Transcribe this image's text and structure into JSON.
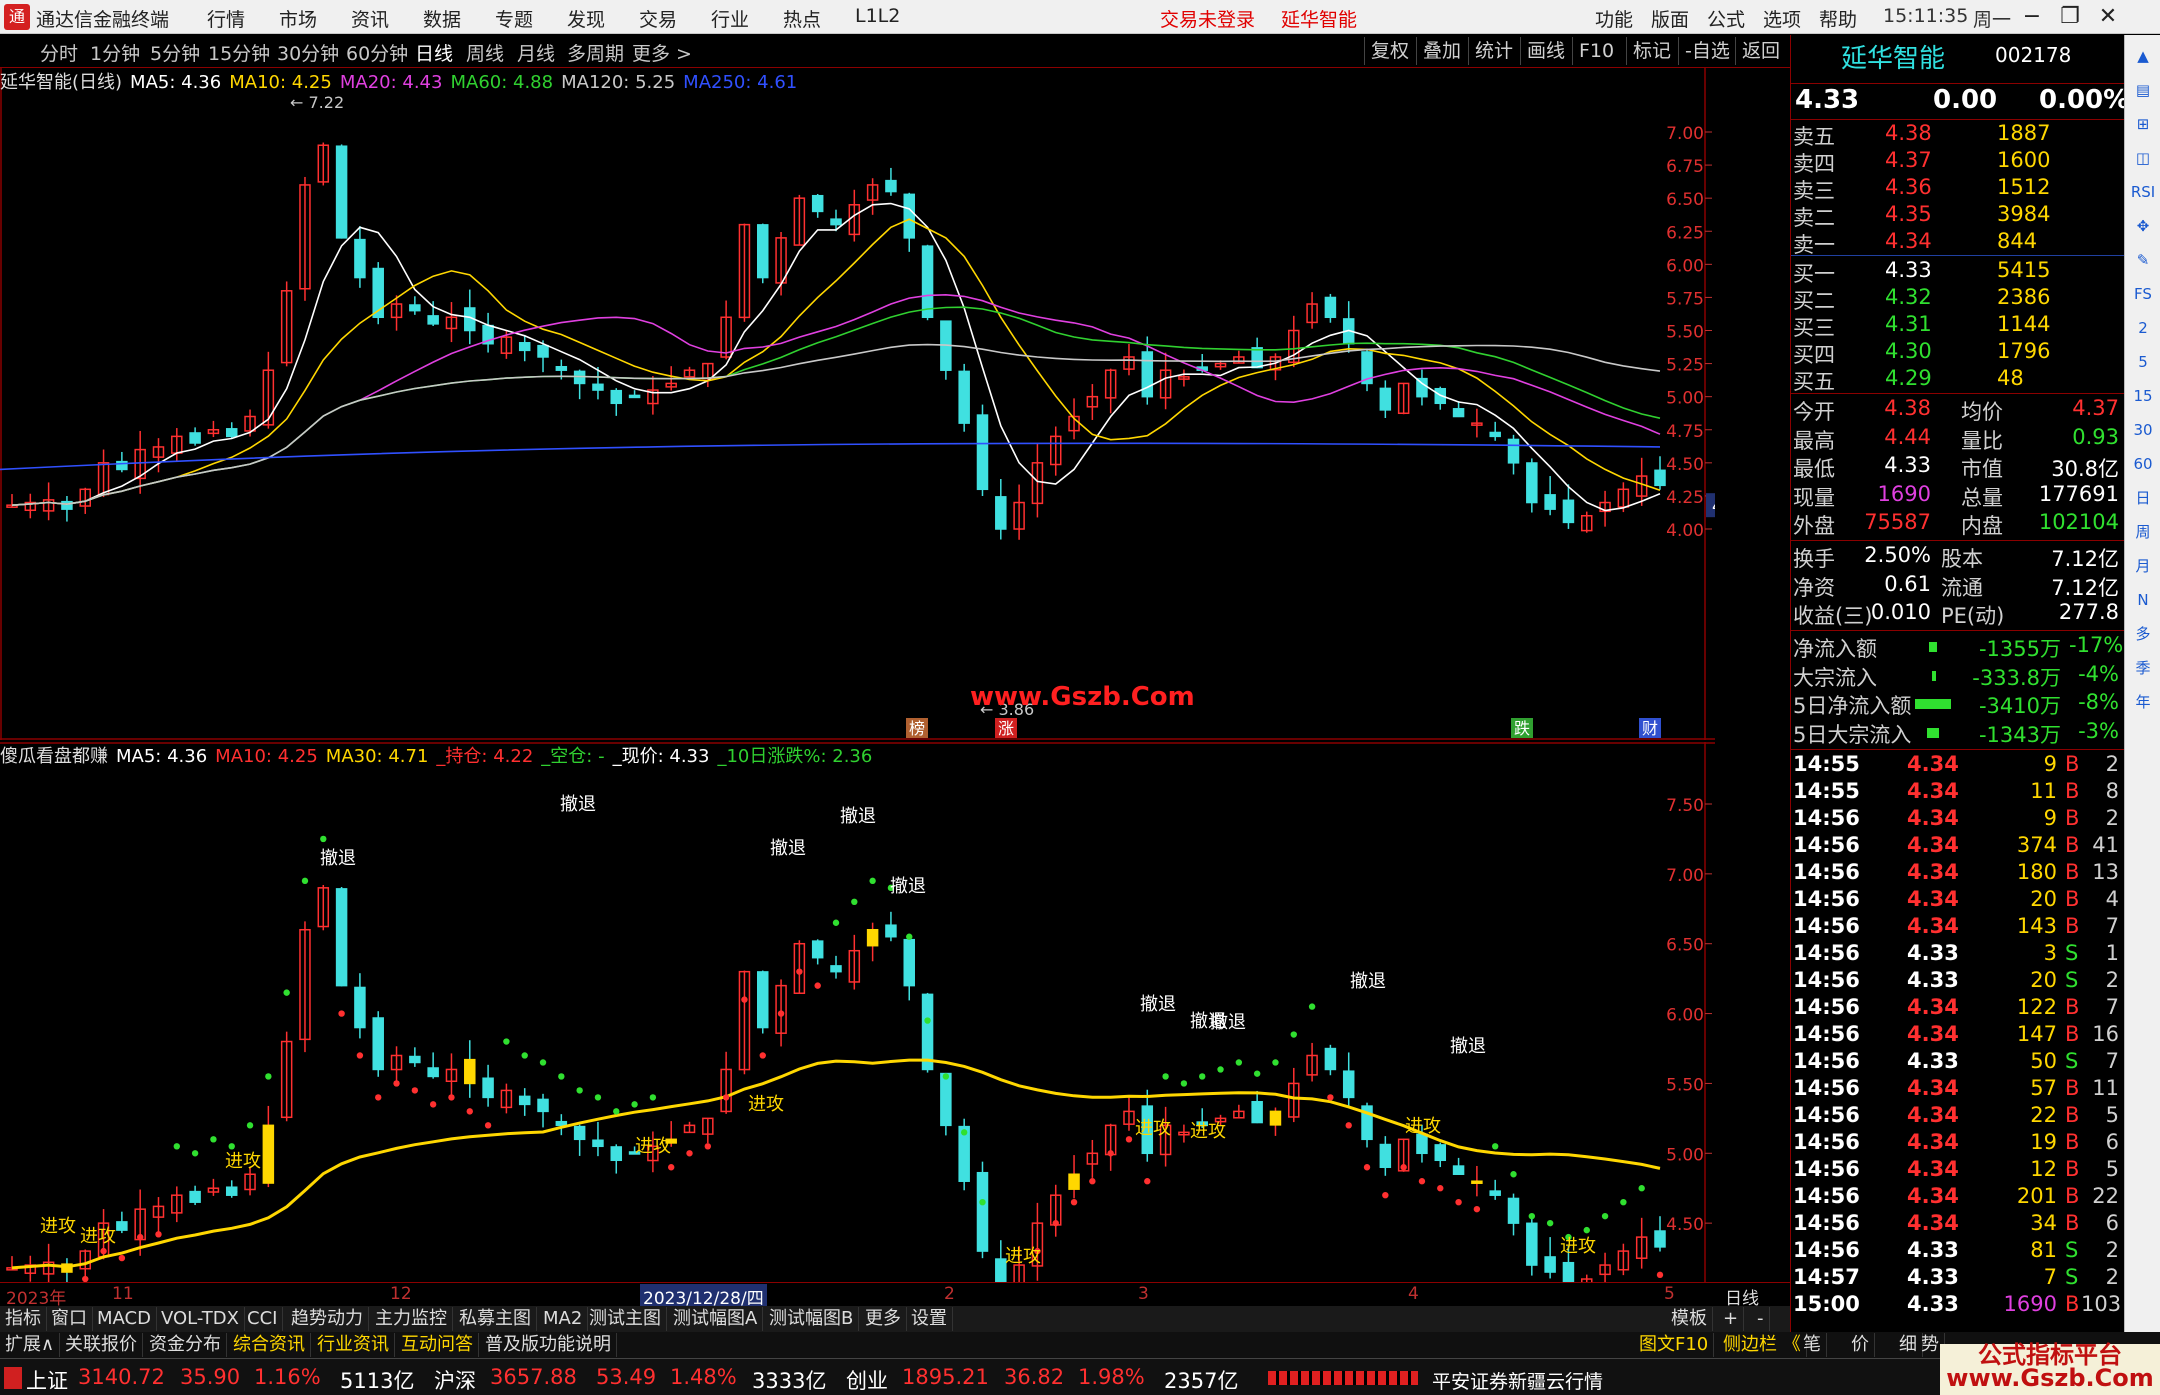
{
  "app": {
    "logo_glyph": "通",
    "title": "通达信金融终端",
    "menus": [
      "行情",
      "市场",
      "资讯",
      "数据",
      "专题",
      "发现",
      "交易",
      "行业",
      "热点",
      "L1L2"
    ],
    "center_links": [
      "交易未登录",
      "延华智能"
    ],
    "right_menus": [
      "功能",
      "版面",
      "公式",
      "选项",
      "帮助"
    ],
    "clock": "15:11:35",
    "weekday": "周一"
  },
  "periods": {
    "items": [
      "分时",
      "1分钟",
      "5分钟",
      "15分钟",
      "30分钟",
      "60分钟",
      "日线",
      "周线",
      "月线",
      "多周期",
      "更多 >"
    ],
    "active": "日线",
    "tools": [
      "复权",
      "叠加",
      "统计",
      "画线",
      "F10",
      "标记",
      "-自选",
      "返回"
    ]
  },
  "main_indicator": {
    "label": "延华智能(日线)",
    "items": [
      {
        "text": "MA5: 4.36",
        "color": "#ffffff"
      },
      {
        "text": "MA10: 4.25",
        "color": "#ffd700"
      },
      {
        "text": "MA20: 4.43",
        "color": "#e040e0"
      },
      {
        "text": "MA60: 4.88",
        "color": "#30d030"
      },
      {
        "text": "MA120: 5.25",
        "color": "#c8c8c8"
      },
      {
        "text": "MA250: 4.61",
        "color": "#3050ff"
      }
    ]
  },
  "main_axis": {
    "ticks": [
      "7.00",
      "6.75",
      "6.50",
      "6.25",
      "6.00",
      "5.75",
      "5.50",
      "5.25",
      "5.00",
      "4.75",
      "4.50",
      "4.25",
      "4.00"
    ],
    "current_price_tag": "4.18",
    "high_mark": "7.22",
    "low_mark": "3.86",
    "event_marks": [
      "榜",
      "涨",
      "跌",
      "财"
    ]
  },
  "sub_indicator": {
    "label": "傻瓜看盘都赚",
    "items": [
      {
        "text": "MA5: 4.36",
        "color": "#ffffff"
      },
      {
        "text": "MA10: 4.25",
        "color": "#ff3030"
      },
      {
        "text": "MA30: 4.71",
        "color": "#ffd700"
      },
      {
        "text": "_持仓: 4.22",
        "color": "#ff3030"
      },
      {
        "text": "_空仓: -",
        "color": "#30d030"
      },
      {
        "text": "_现价: 4.33",
        "color": "#ffffff"
      },
      {
        "text": "_10日涨跌%: 2.36",
        "color": "#30d030"
      }
    ],
    "ticks": [
      "7.50",
      "7.00",
      "6.50",
      "6.00",
      "5.50",
      "5.00",
      "4.50",
      "4.00"
    ],
    "signal_retreat": "撤退",
    "signal_attack": "进攻"
  },
  "watermark_site": "www.Gszb.Com",
  "time_axis": {
    "labels": [
      "2023年",
      "11",
      "12",
      "2023/12/28/四",
      "2",
      "3",
      "4",
      "5"
    ],
    "period": "日线"
  },
  "tabs1": [
    "指标",
    "窗口",
    "MACD",
    "VOL-TDX",
    "CCI",
    "趋势动力",
    "主力监控",
    "私募主图",
    "MA2",
    "测试主图",
    "测试幅图A",
    "测试幅图B",
    "更多",
    "设置"
  ],
  "tabs1_right": [
    "模板",
    "+",
    "-"
  ],
  "tabs2": [
    "扩展∧",
    "关联报价",
    "资金分布",
    "综合资讯",
    "行业资讯",
    "互动问答",
    "普及版功能说明"
  ],
  "tabs2_right": [
    "图文F10",
    "侧边栏 《",
    "笔",
    "价",
    "细",
    "势"
  ],
  "quote": {
    "name": "延华智能",
    "code": "002178",
    "price": "4.33",
    "change": "0.00",
    "change_pct": "0.00%",
    "asks": [
      {
        "label": "卖五",
        "price": "4.38",
        "vol": "1887"
      },
      {
        "label": "卖四",
        "price": "4.37",
        "vol": "1600"
      },
      {
        "label": "卖三",
        "price": "4.36",
        "vol": "1512"
      },
      {
        "label": "卖二",
        "price": "4.35",
        "vol": "3984"
      },
      {
        "label": "卖一",
        "price": "4.34",
        "vol": "844"
      }
    ],
    "bids": [
      {
        "label": "买一",
        "price": "4.33",
        "vol": "5415"
      },
      {
        "label": "买二",
        "price": "4.32",
        "vol": "2386"
      },
      {
        "label": "买三",
        "price": "4.31",
        "vol": "1144"
      },
      {
        "label": "买四",
        "price": "4.30",
        "vol": "1796"
      },
      {
        "label": "买五",
        "price": "4.29",
        "vol": "48"
      }
    ],
    "stats": [
      {
        "l1": "今开",
        "v1": "4.38",
        "c1": "red",
        "l2": "均价",
        "v2": "4.37",
        "c2": "red"
      },
      {
        "l1": "最高",
        "v1": "4.44",
        "c1": "red",
        "l2": "量比",
        "v2": "0.93",
        "c2": "grn"
      },
      {
        "l1": "最低",
        "v1": "4.33",
        "c1": "wht",
        "l2": "市值",
        "v2": "30.8亿",
        "c2": "wht"
      },
      {
        "l1": "现量",
        "v1": "1690",
        "c1": "pur",
        "l2": "总量",
        "v2": "177691",
        "c2": "wht"
      },
      {
        "l1": "外盘",
        "v1": "75587",
        "c1": "red",
        "l2": "内盘",
        "v2": "102104",
        "c2": "grn"
      }
    ],
    "stats2": [
      {
        "l1": "换手",
        "v1": "2.50%",
        "l2": "股本",
        "v2": "7.12亿"
      },
      {
        "l1": "净资",
        "v1": "0.61",
        "l2": "流通",
        "v2": "7.12亿"
      },
      {
        "l1": "收益(三)",
        "v1": "0.010",
        "l2": "PE(动)",
        "v2": "277.8"
      }
    ],
    "flows": [
      {
        "label": "净流入额",
        "val": "-1355万",
        "pct": "-17%",
        "bar": 0.1
      },
      {
        "label": "大宗流入",
        "val": "-333.8万",
        "pct": "-4%",
        "bar": 0.02
      },
      {
        "label": "5日净流入额",
        "val": "-3410万",
        "pct": "-8%",
        "bar": 0.45
      },
      {
        "label": "5日大宗流入",
        "val": "-1343万",
        "pct": "-3%",
        "bar": 0.15
      }
    ],
    "ticks": [
      {
        "t": "14:55",
        "p": "4.34",
        "v": "9",
        "bs": "B",
        "n": "2"
      },
      {
        "t": "14:55",
        "p": "4.34",
        "v": "11",
        "bs": "B",
        "n": "8"
      },
      {
        "t": "14:56",
        "p": "4.34",
        "v": "9",
        "bs": "B",
        "n": "2"
      },
      {
        "t": "14:56",
        "p": "4.34",
        "v": "374",
        "bs": "B",
        "n": "41"
      },
      {
        "t": "14:56",
        "p": "4.34",
        "v": "180",
        "bs": "B",
        "n": "13"
      },
      {
        "t": "14:56",
        "p": "4.34",
        "v": "20",
        "bs": "B",
        "n": "4"
      },
      {
        "t": "14:56",
        "p": "4.34",
        "v": "143",
        "bs": "B",
        "n": "7"
      },
      {
        "t": "14:56",
        "p": "4.33",
        "v": "3",
        "bs": "S",
        "n": "1"
      },
      {
        "t": "14:56",
        "p": "4.33",
        "v": "20",
        "bs": "S",
        "n": "2"
      },
      {
        "t": "14:56",
        "p": "4.34",
        "v": "122",
        "bs": "B",
        "n": "7"
      },
      {
        "t": "14:56",
        "p": "4.34",
        "v": "147",
        "bs": "B",
        "n": "16"
      },
      {
        "t": "14:56",
        "p": "4.33",
        "v": "50",
        "bs": "S",
        "n": "7"
      },
      {
        "t": "14:56",
        "p": "4.34",
        "v": "57",
        "bs": "B",
        "n": "11"
      },
      {
        "t": "14:56",
        "p": "4.34",
        "v": "22",
        "bs": "B",
        "n": "5"
      },
      {
        "t": "14:56",
        "p": "4.34",
        "v": "19",
        "bs": "B",
        "n": "6"
      },
      {
        "t": "14:56",
        "p": "4.34",
        "v": "12",
        "bs": "B",
        "n": "5"
      },
      {
        "t": "14:56",
        "p": "4.34",
        "v": "201",
        "bs": "B",
        "n": "22"
      },
      {
        "t": "14:56",
        "p": "4.34",
        "v": "34",
        "bs": "B",
        "n": "6"
      },
      {
        "t": "14:56",
        "p": "4.33",
        "v": "81",
        "bs": "S",
        "n": "2"
      },
      {
        "t": "14:57",
        "p": "4.33",
        "v": "7",
        "bs": "S",
        "n": "2"
      },
      {
        "t": "15:00",
        "p": "4.33",
        "v": "1690",
        "bs": "B",
        "n": "103"
      }
    ]
  },
  "sidebar_icons": [
    "up-arrow",
    "menu",
    "chart",
    "calendar",
    "rsi",
    "compass",
    "pen",
    "fs",
    "num-2",
    "num-5",
    "num-15",
    "num-30",
    "num-60",
    "日",
    "周",
    "月",
    "N",
    "多",
    "季",
    "年"
  ],
  "sidebar_labels": [
    "▲",
    "▤",
    "⊞",
    "◫",
    "RSI",
    "✥",
    "✎",
    "FS",
    "2",
    "5",
    "15",
    "30",
    "60",
    "日",
    "周",
    "月",
    "N",
    "多",
    "季",
    "年"
  ],
  "statusbar": {
    "items": [
      {
        "name": "上证",
        "price": "3140.72",
        "chg": "35.90",
        "pct": "1.16%",
        "amt": "5113亿"
      },
      {
        "name": "沪深",
        "price": "3657.88",
        "chg": "53.49",
        "pct": "1.48%",
        "amt": "3333亿"
      },
      {
        "name": "创业",
        "price": "1895.21",
        "chg": "36.82",
        "pct": "1.98%",
        "amt": "2357亿"
      }
    ],
    "broker": "平安证券新疆云行情"
  },
  "corner_watermark": {
    "line1": "公式指标平台",
    "line2": "www.Gszb.Com"
  }
}
